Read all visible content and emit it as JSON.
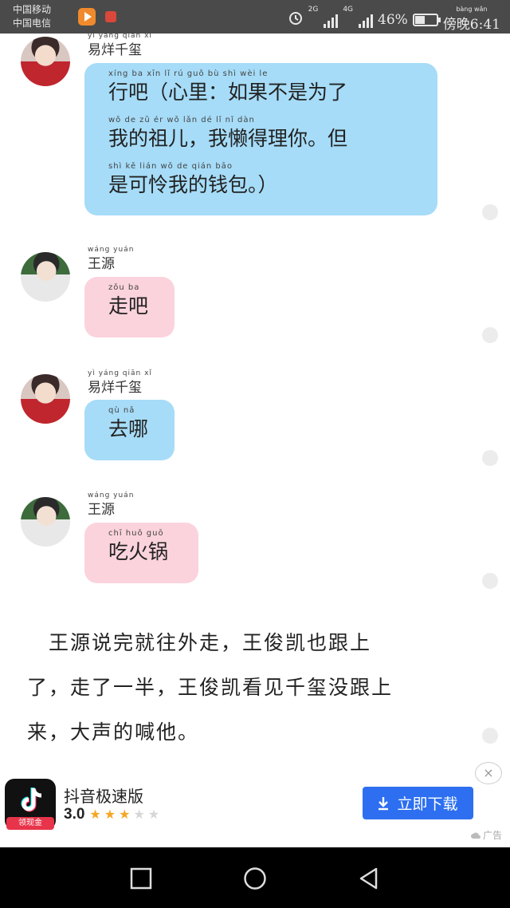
{
  "status_bar": {
    "carrier_1": "中国移动",
    "carrier_2": "中国电信",
    "net_1": "2G",
    "net_2": "4G",
    "battery_text": "46%",
    "battery_level": 0.46,
    "clock_pinyin": "bàng wǎn",
    "clock": "傍晚6:41"
  },
  "messages": [
    {
      "sender": "易烊千玺",
      "sender_pinyin": "yì yáng qiān xǐ",
      "bubble_color": "#a6dcf8",
      "lines": [
        {
          "pinyin": "xíng ba   xīn lǐ   rú guǒ bù shì wèi le",
          "text": "行吧（心里：如果不是为了"
        },
        {
          "pinyin": "wǒ de zǔ ér   wǒ lǎn dé lǐ nǐ   dàn",
          "text": "我的祖儿，我懒得理你。但"
        },
        {
          "pinyin": "shì kě lián wǒ de qián bāo",
          "text": "是可怜我的钱包。）"
        }
      ]
    },
    {
      "sender": "王源",
      "sender_pinyin": "wáng yuán",
      "bubble_color": "#fbd3dd",
      "lines": [
        {
          "pinyin": "zǒu ba",
          "text": "走吧"
        }
      ]
    },
    {
      "sender": "易烊千玺",
      "sender_pinyin": "yì yáng qiān xǐ",
      "bubble_color": "#a6dcf8",
      "lines": [
        {
          "pinyin": "qù nǎ",
          "text": "去哪"
        }
      ]
    },
    {
      "sender": "王源",
      "sender_pinyin": "wáng yuán",
      "bubble_color": "#fbd3dd",
      "lines": [
        {
          "pinyin": "chī huǒ guō",
          "text": "吃火锅"
        }
      ]
    }
  ],
  "narration": [
    "　王源说完就往外走，王俊凯也跟上",
    "了，走了一半，王俊凯看见千玺没跟上",
    "来，大声的喊他。"
  ],
  "ad": {
    "app_name": "抖音极速版",
    "rating": "3.0",
    "stars_filled": 3,
    "stars_total": 5,
    "icon_tag": "领现金",
    "download_label": "立即下载",
    "close_symbol": "×",
    "ad_label": "广告"
  }
}
